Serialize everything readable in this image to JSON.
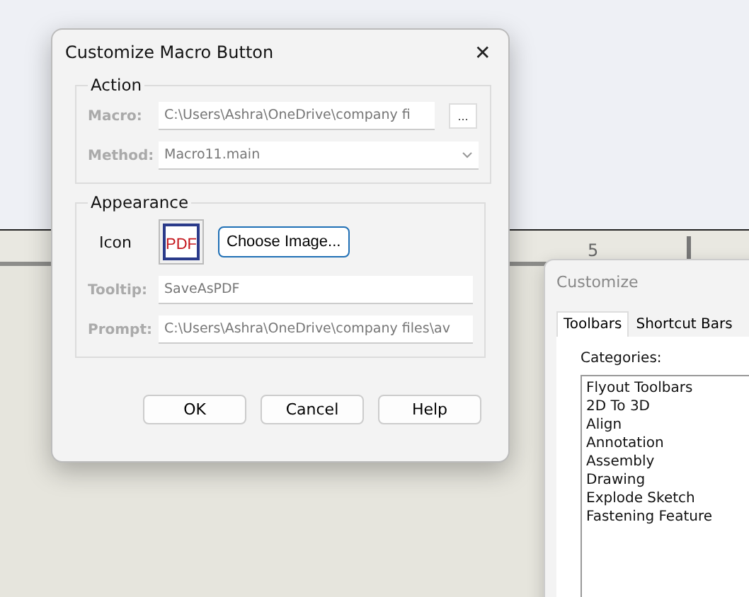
{
  "ruler": {
    "label": "5"
  },
  "dialog": {
    "title": "Customize Macro Button",
    "close": "✕",
    "action": {
      "legend": "Action",
      "rows": [
        {
          "kind": "browse",
          "label": "Macro:",
          "value": "C:\\Users\\Ashra\\OneDrive\\company fi",
          "button": "...",
          "disabled": true
        },
        {
          "kind": "select",
          "label": "Method:",
          "value": "Macro11.main",
          "disabled": true
        }
      ]
    },
    "appearance": {
      "legend": "Appearance",
      "icon_label": "Icon",
      "icon_text": "PDF",
      "choose": "Choose Image...",
      "rows": [
        {
          "kind": "text",
          "label": "Tooltip:",
          "value": "SaveAsPDF",
          "disabled": true
        },
        {
          "kind": "text",
          "label": "Prompt:",
          "value": "C:\\Users\\Ashra\\OneDrive\\company files\\av",
          "disabled": true
        }
      ]
    },
    "buttons": [
      "OK",
      "Cancel",
      "Help"
    ]
  },
  "customize": {
    "title": "Customize",
    "tabs": [
      {
        "label": "Toolbars",
        "selected": true
      },
      {
        "label": "Shortcut Bars",
        "selected": false
      }
    ],
    "categories_label": "Categories:",
    "categories": [
      "Flyout Toolbars",
      "2D To 3D",
      "Align",
      "Annotation",
      "Assembly",
      "Drawing",
      "Explode Sketch",
      "Fastening Feature"
    ]
  }
}
